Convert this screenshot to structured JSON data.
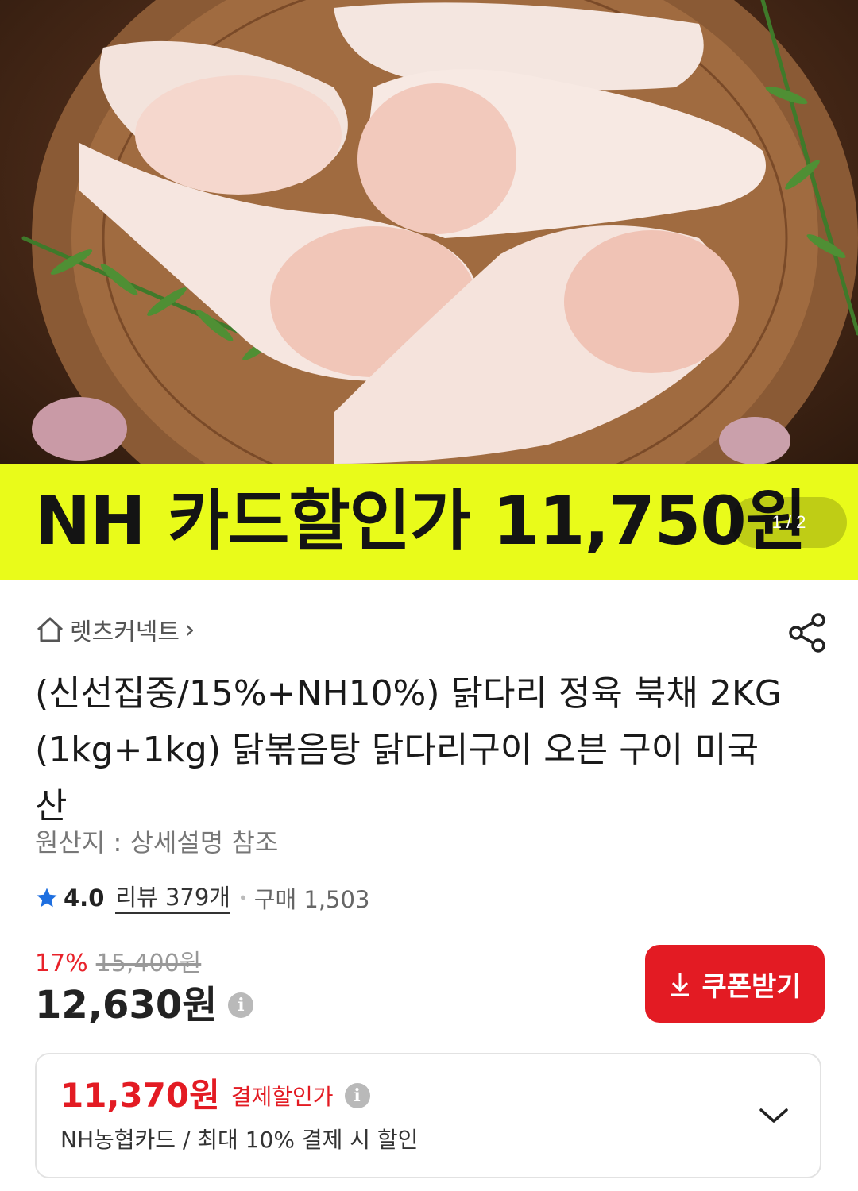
{
  "hero": {
    "banner_text": "NH 카드할인가 11,750원",
    "page_indicator": "1 / 2"
  },
  "store": {
    "name": "렛츠커넥트",
    "icon": "home-icon",
    "arrow": "›"
  },
  "product": {
    "title": "(신선집중/15%+NH10%) 닭다리 정육 북채 2KG (1kg+1kg) 닭볶음탕 닭다리구이 오븐 구이 미국산",
    "origin": "원산지 : 상세설명 참조"
  },
  "rating": {
    "score": "4.0",
    "reviews": "리뷰 379개",
    "purchases": "구매 1,503"
  },
  "pricing": {
    "discount_rate": "17%",
    "original_price": "15,400원",
    "price": "12,630원",
    "coupon_label": "쿠폰받기",
    "accent_color": "#e31b23"
  },
  "card_offer": {
    "price": "11,370원",
    "label": "결제할인가",
    "description": "NH농협카드 / 최대 10% 결제 시 할인"
  }
}
